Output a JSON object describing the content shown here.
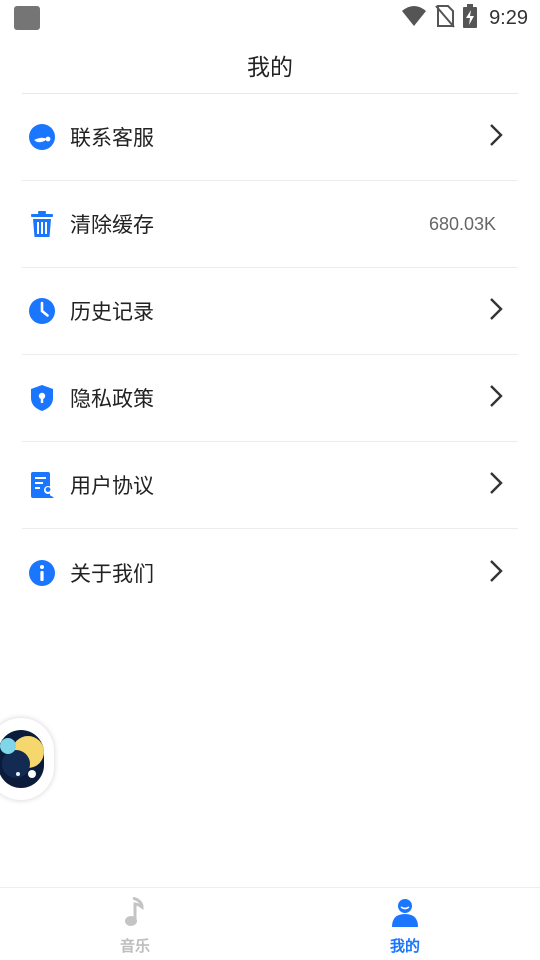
{
  "status_bar": {
    "time": "9:29"
  },
  "header": {
    "title": "我的"
  },
  "menu": {
    "items": [
      {
        "label": "联系客服",
        "icon": "customer-service-icon"
      },
      {
        "label": "清除缓存",
        "icon": "trash-icon",
        "value": "680.03K"
      },
      {
        "label": "历史记录",
        "icon": "clock-icon"
      },
      {
        "label": "隐私政策",
        "icon": "shield-lock-icon"
      },
      {
        "label": "用户协议",
        "icon": "agreement-document-icon"
      },
      {
        "label": "关于我们",
        "icon": "info-icon"
      }
    ]
  },
  "bottom_nav": {
    "tabs": [
      {
        "label": "音乐",
        "icon": "music-note-icon",
        "active": false
      },
      {
        "label": "我的",
        "icon": "user-icon",
        "active": true
      }
    ]
  },
  "colors": {
    "accent": "#1a75ff",
    "inactive": "#bdbdbd"
  }
}
